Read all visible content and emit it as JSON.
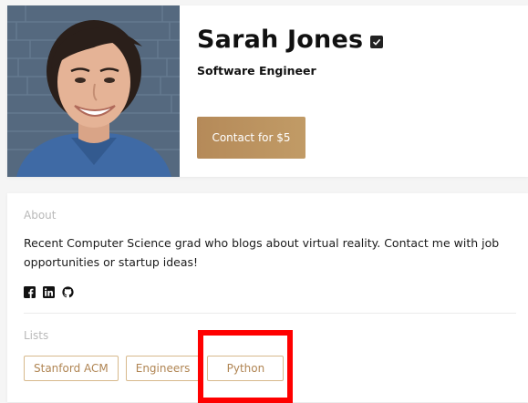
{
  "profile": {
    "name": "Sarah Jones",
    "title": "Software Engineer",
    "contact_label": "Contact for $5",
    "verified_icon": "checkbox-checked-icon"
  },
  "about": {
    "label": "About",
    "bio": "Recent Computer Science grad who blogs about virtual reality. Contact me with job opportunities or startup ideas!",
    "social_icons": [
      "facebook-icon",
      "linkedin-icon",
      "github-icon"
    ]
  },
  "lists": {
    "label": "Lists",
    "tags": [
      "Stanford ACM",
      "Engineers",
      "Python"
    ]
  },
  "colors": {
    "accent": "#b58a59",
    "tag_border": "#d7b98c",
    "tag_text": "#b08553",
    "highlight": "#ff0000"
  }
}
